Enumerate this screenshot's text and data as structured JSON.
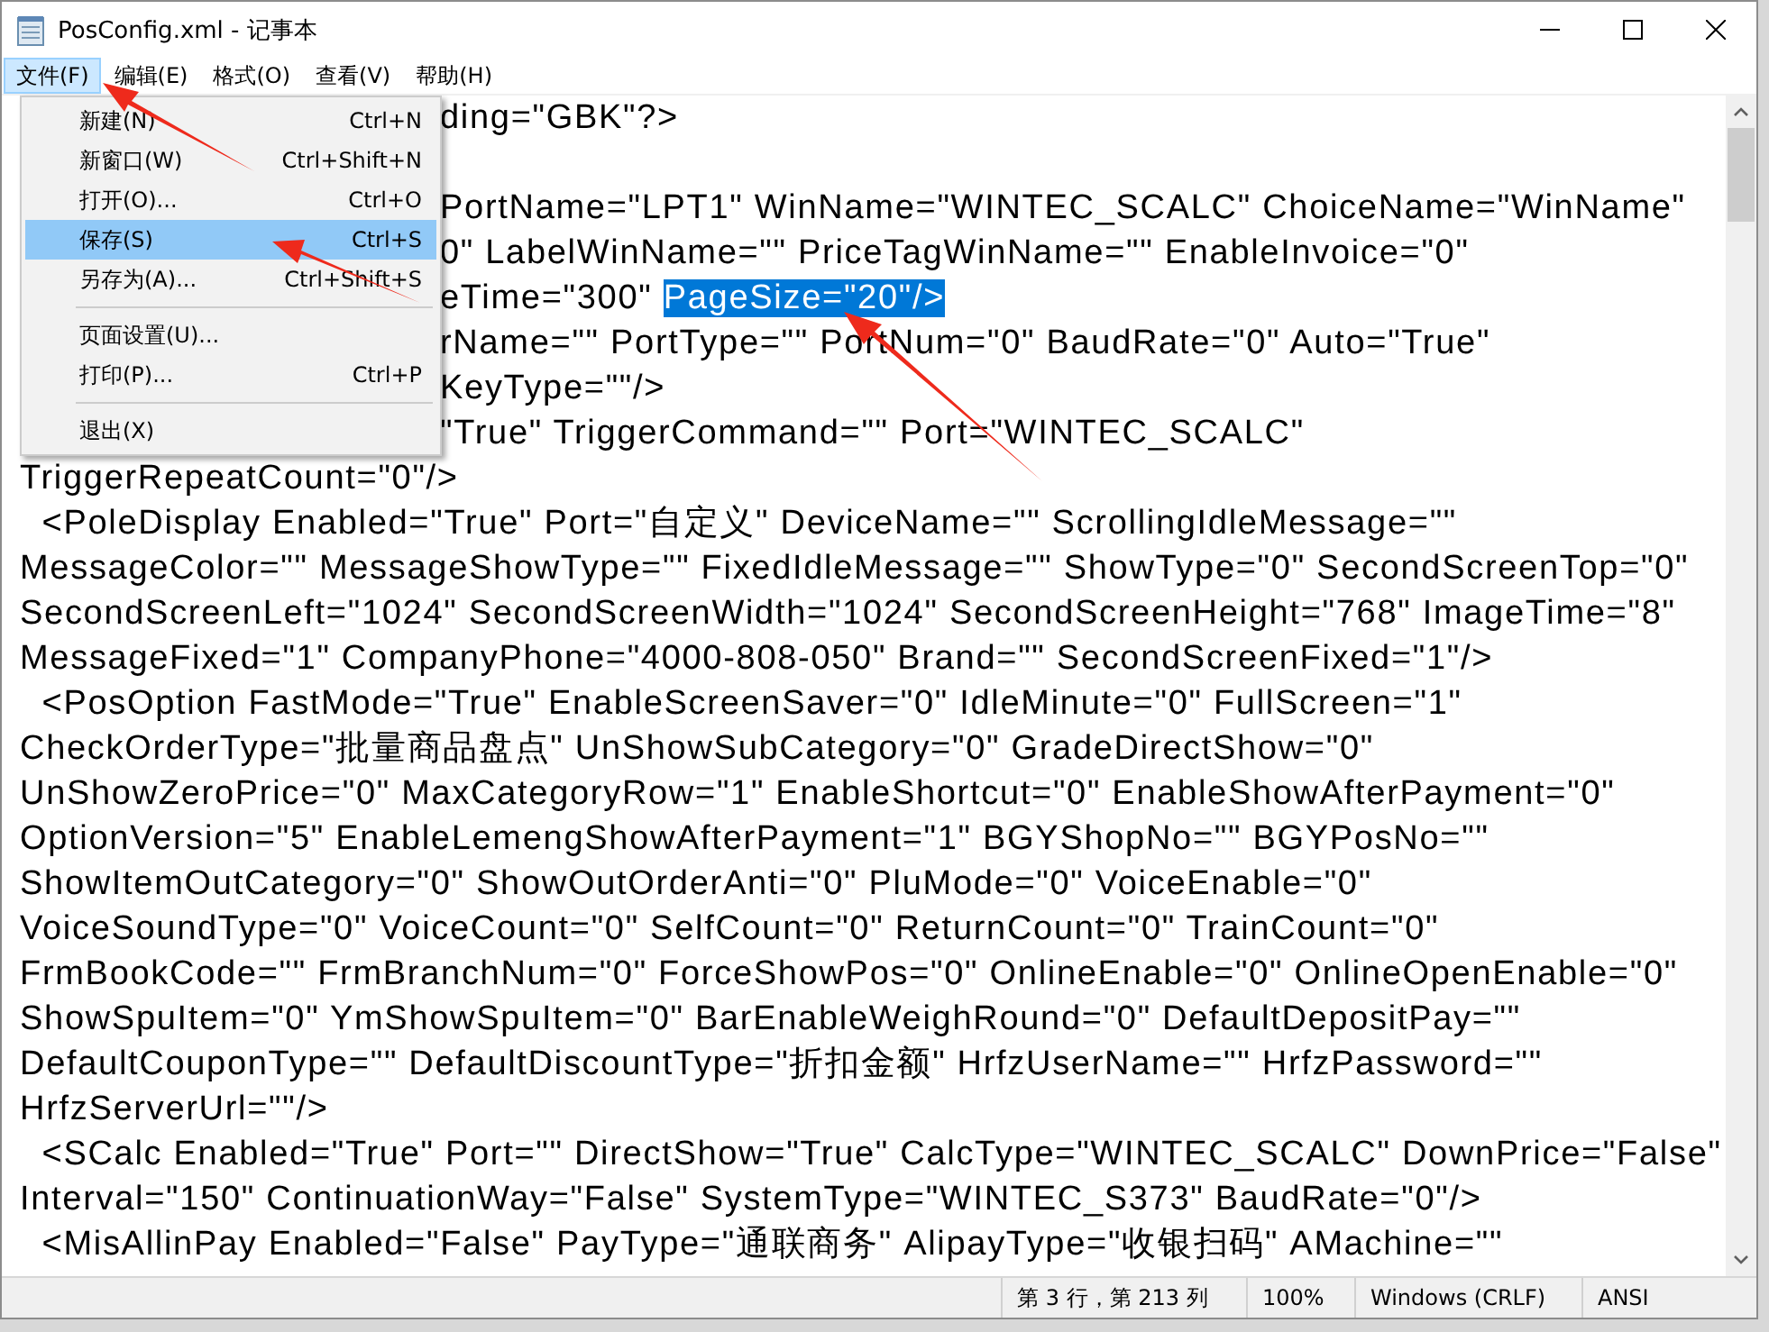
{
  "window": {
    "title": "PosConfig.xml - 记事本"
  },
  "menu_bar": [
    {
      "label": "文件(F)",
      "selected": true
    },
    {
      "label": "编辑(E)",
      "selected": false
    },
    {
      "label": "格式(O)",
      "selected": false
    },
    {
      "label": "查看(V)",
      "selected": false
    },
    {
      "label": "帮助(H)",
      "selected": false
    }
  ],
  "file_menu": [
    {
      "kind": "item",
      "label": "新建(N)",
      "shortcut": "Ctrl+N",
      "selected": false
    },
    {
      "kind": "item",
      "label": "新窗口(W)",
      "shortcut": "Ctrl+Shift+N",
      "selected": false
    },
    {
      "kind": "item",
      "label": "打开(O)...",
      "shortcut": "Ctrl+O",
      "selected": false
    },
    {
      "kind": "item",
      "label": "保存(S)",
      "shortcut": "Ctrl+S",
      "selected": true
    },
    {
      "kind": "item",
      "label": "另存为(A)...",
      "shortcut": "Ctrl+Shift+S",
      "selected": false
    },
    {
      "kind": "separator"
    },
    {
      "kind": "item",
      "label": "页面设置(U)...",
      "selected": false
    },
    {
      "kind": "item",
      "label": "打印(P)...",
      "shortcut": "Ctrl+P",
      "selected": false
    },
    {
      "kind": "separator"
    },
    {
      "kind": "item",
      "label": "退出(X)",
      "selected": false
    }
  ],
  "editor_lines": [
    {
      "kind": "partial",
      "parts": [
        {
          "text": "ding=\"GBK\"?>",
          "selected": false
        }
      ]
    },
    {
      "kind": "blank"
    },
    {
      "kind": "partial",
      "parts": [
        {
          "text": "PortName=\"LPT1\" WinName=\"WINTEC_SCALC\" ChoiceName=\"WinName\"",
          "selected": false
        }
      ]
    },
    {
      "kind": "partial",
      "parts": [
        {
          "text": "0\" LabelWinName=\"\" PriceTagWinName=\"\" EnableInvoice=\"0\"",
          "selected": false
        }
      ]
    },
    {
      "kind": "partial",
      "parts": [
        {
          "text": "eTime=\"300\" ",
          "selected": false
        },
        {
          "text": "PageSize=\"20\"/>",
          "selected": true
        }
      ]
    },
    {
      "kind": "partial",
      "parts": [
        {
          "text": "rName=\"\" PortType=\"\" PortNum=\"0\" BaudRate=\"0\" Auto=\"True\"",
          "selected": false
        }
      ]
    },
    {
      "kind": "partial",
      "parts": [
        {
          "text": "KeyType=\"\"/>",
          "selected": false
        }
      ]
    },
    {
      "kind": "partial",
      "parts": [
        {
          "text": "\"True\" TriggerCommand=\"\" Port=\"WINTEC_SCALC\"",
          "selected": false
        }
      ]
    },
    {
      "kind": "full",
      "parts": [
        {
          "text": "TriggerRepeatCount=\"0\"/>",
          "selected": false
        }
      ]
    },
    {
      "kind": "full",
      "parts": [
        {
          "text": "  <PoleDisplay Enabled=\"True\" Port=\"自定义\" DeviceName=\"\" ScrollingIdleMessage=\"\"",
          "selected": false
        }
      ]
    },
    {
      "kind": "full",
      "parts": [
        {
          "text": "MessageColor=\"\" MessageShowType=\"\" FixedIdleMessage=\"\" ShowType=\"0\" SecondScreenTop=\"0\"",
          "selected": false
        }
      ]
    },
    {
      "kind": "full",
      "parts": [
        {
          "text": "SecondScreenLeft=\"1024\" SecondScreenWidth=\"1024\" SecondScreenHeight=\"768\" ImageTime=\"8\"",
          "selected": false
        }
      ]
    },
    {
      "kind": "full",
      "parts": [
        {
          "text": "MessageFixed=\"1\" CompanyPhone=\"4000-808-050\" Brand=\"\" SecondScreenFixed=\"1\"/>",
          "selected": false
        }
      ]
    },
    {
      "kind": "full",
      "parts": [
        {
          "text": "  <PosOption FastMode=\"True\" EnableScreenSaver=\"0\" IdleMinute=\"0\" FullScreen=\"1\"",
          "selected": false
        }
      ]
    },
    {
      "kind": "full",
      "parts": [
        {
          "text": "CheckOrderType=\"批量商品盘点\" UnShowSubCategory=\"0\" GradeDirectShow=\"0\"",
          "selected": false
        }
      ]
    },
    {
      "kind": "full",
      "parts": [
        {
          "text": "UnShowZeroPrice=\"0\" MaxCategoryRow=\"1\" EnableShortcut=\"0\" EnableShowAfterPayment=\"0\"",
          "selected": false
        }
      ]
    },
    {
      "kind": "full",
      "parts": [
        {
          "text": "OptionVersion=\"5\" EnableLemengShowAfterPayment=\"1\" BGYShopNo=\"\" BGYPosNo=\"\"",
          "selected": false
        }
      ]
    },
    {
      "kind": "full",
      "parts": [
        {
          "text": "ShowItemOutCategory=\"0\" ShowOutOrderAnti=\"0\" PluMode=\"0\" VoiceEnable=\"0\"",
          "selected": false
        }
      ]
    },
    {
      "kind": "full",
      "parts": [
        {
          "text": "VoiceSoundType=\"0\" VoiceCount=\"0\" SelfCount=\"0\" ReturnCount=\"0\" TrainCount=\"0\"",
          "selected": false
        }
      ]
    },
    {
      "kind": "full",
      "parts": [
        {
          "text": "FrmBookCode=\"\" FrmBranchNum=\"0\" ForceShowPos=\"0\" OnlineEnable=\"0\" OnlineOpenEnable=\"0\"",
          "selected": false
        }
      ]
    },
    {
      "kind": "full",
      "parts": [
        {
          "text": "ShowSpuItem=\"0\" YmShowSpuItem=\"0\" BarEnableWeighRound=\"0\" DefaultDepositPay=\"\"",
          "selected": false
        }
      ]
    },
    {
      "kind": "full",
      "parts": [
        {
          "text": "DefaultCouponType=\"\" DefaultDiscountType=\"折扣金额\" HrfzUserName=\"\" HrfzPassword=\"\"",
          "selected": false
        }
      ]
    },
    {
      "kind": "full",
      "parts": [
        {
          "text": "HrfzServerUrl=\"\"/>",
          "selected": false
        }
      ]
    },
    {
      "kind": "full",
      "parts": [
        {
          "text": "  <SCalc Enabled=\"True\" Port=\"\" DirectShow=\"True\" CalcType=\"WINTEC_SCALC\" DownPrice=\"False\"",
          "selected": false
        }
      ]
    },
    {
      "kind": "full",
      "parts": [
        {
          "text": "Interval=\"150\" ContinuationWay=\"False\" SystemType=\"WINTEC_S373\" BaudRate=\"0\"/>",
          "selected": false
        }
      ]
    },
    {
      "kind": "full",
      "parts": [
        {
          "text": "  <MisAllinPay Enabled=\"False\" PayType=\"通联商务\" AlipayType=\"收银扫码\" AMachine=\"\"",
          "selected": false
        }
      ]
    }
  ],
  "status_bar": [
    "第 3 行，第 213 列",
    "100%",
    "Windows (CRLF)",
    "ANSI"
  ]
}
